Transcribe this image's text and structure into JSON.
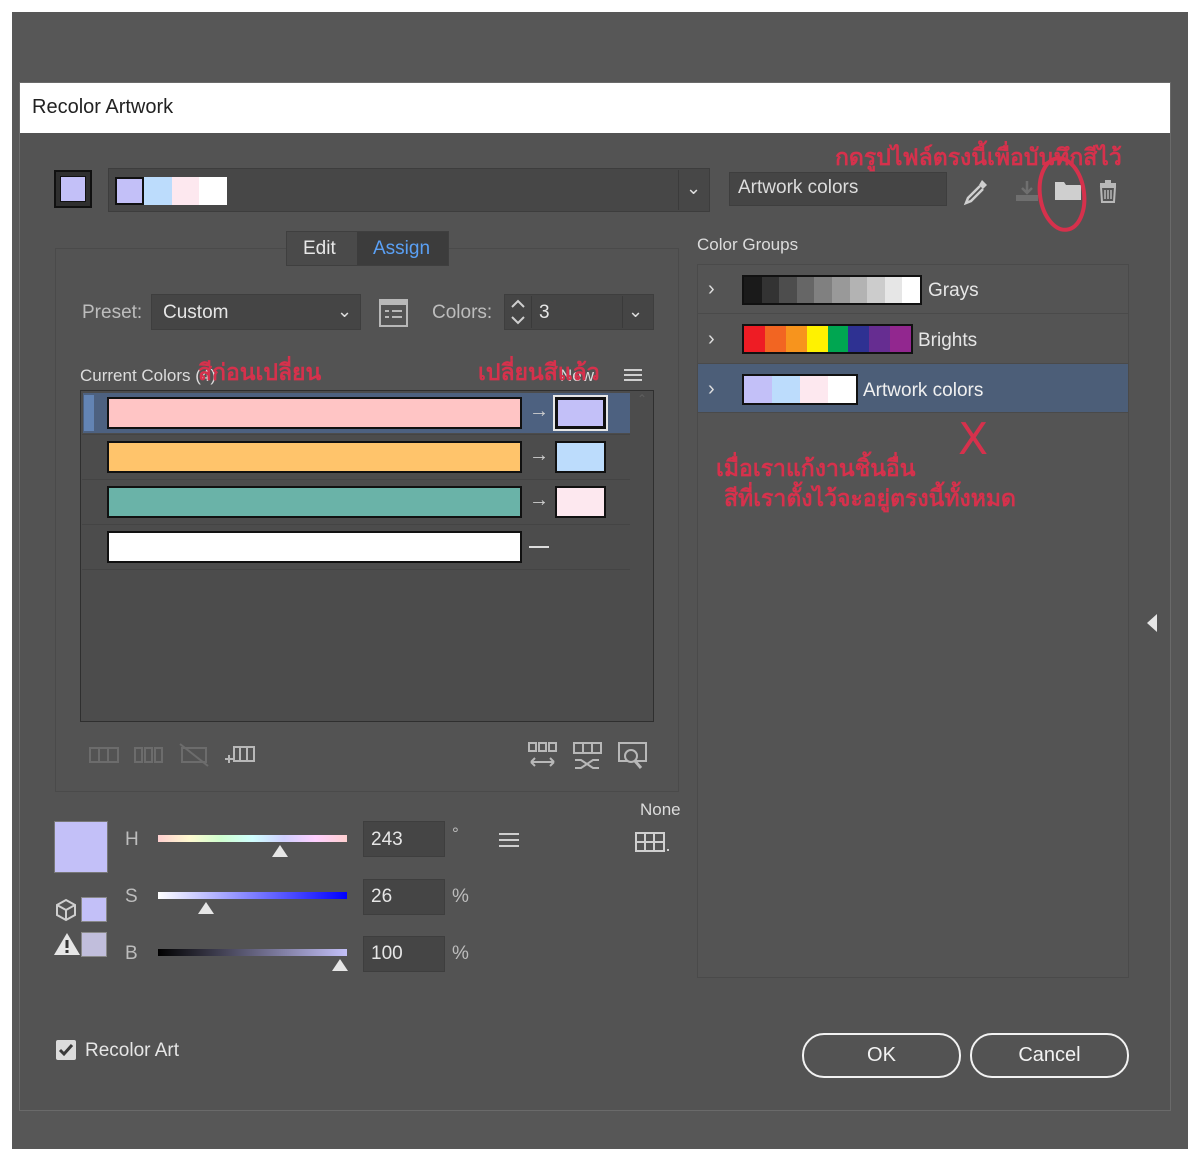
{
  "dialog": {
    "title": "Recolor Artwork"
  },
  "top_bar": {
    "group_name_value": "Artwork colors",
    "strip_colors": [
      "#c3c0f8",
      "#bcdcfc",
      "#fde8ef",
      "#ffffff"
    ]
  },
  "tabs": {
    "edit": "Edit",
    "assign": "Assign",
    "active": "Assign"
  },
  "preset": {
    "label": "Preset:",
    "value": "Custom"
  },
  "colors": {
    "label": "Colors:",
    "value": "3"
  },
  "current_colors": {
    "header": "Current Colors (4)",
    "new_header": "New",
    "rows": [
      {
        "current": "#ffc5c5",
        "new": "#c3c0f8",
        "selected": true
      },
      {
        "current": "#ffc46b",
        "new": "#bcdcfc",
        "selected": false
      },
      {
        "current": "#6ab3a8",
        "new": "#fde8ef",
        "selected": false
      },
      {
        "current": "#ffffff",
        "new": null,
        "selected": false
      }
    ]
  },
  "hsb": {
    "h_label": "H",
    "h_value": "243",
    "h_unit": "°",
    "h_level": 0.67,
    "s_label": "S",
    "s_value": "26",
    "s_unit": "%",
    "s_level": 0.26,
    "b_label": "B",
    "b_value": "100",
    "b_unit": "%",
    "b_level": 1.0,
    "swatch_color": "#c3c0f8"
  },
  "none_label": "None",
  "color_groups": {
    "header": "Color Groups",
    "items": [
      {
        "name": "Grays",
        "colors": [
          "#1a1a1a",
          "#333333",
          "#4d4d4d",
          "#666666",
          "#808080",
          "#999999",
          "#b3b3b3",
          "#cccccc",
          "#e6e6e6",
          "#ffffff"
        ],
        "selected": false
      },
      {
        "name": "Brights",
        "colors": [
          "#ee1c24",
          "#f26522",
          "#f7941d",
          "#fff200",
          "#00a651",
          "#2e3192",
          "#662d91",
          "#92278f"
        ],
        "selected": false
      },
      {
        "name": "Artwork colors",
        "colors": [
          "#c3c0f8",
          "#bcdcfc",
          "#fde8ef",
          "#ffffff"
        ],
        "selected": true
      }
    ]
  },
  "recolor_art": {
    "label": "Recolor Art",
    "checked": true
  },
  "buttons": {
    "ok": "OK",
    "cancel": "Cancel"
  },
  "annotations": {
    "save_hint": "กดรูปไฟล์ตรงนี้เพื่อบันทึกสีไว้",
    "before": "สีก่อนเปลี่ยน",
    "after": "เปลี่ยนสีแล้ว",
    "note_line1": "เมื่อเราแก้งานชิ้นอื่น",
    "note_line2": "สีที่เราตั้งไว้จะอยู่ตรงนี้ทั้งหมด",
    "x_mark": "X"
  },
  "icons": [
    "eyedropper-icon",
    "save-group-icon",
    "new-folder-icon",
    "trash-icon",
    "panel-collapse-icon",
    "menu-icon",
    "grid-icon"
  ]
}
